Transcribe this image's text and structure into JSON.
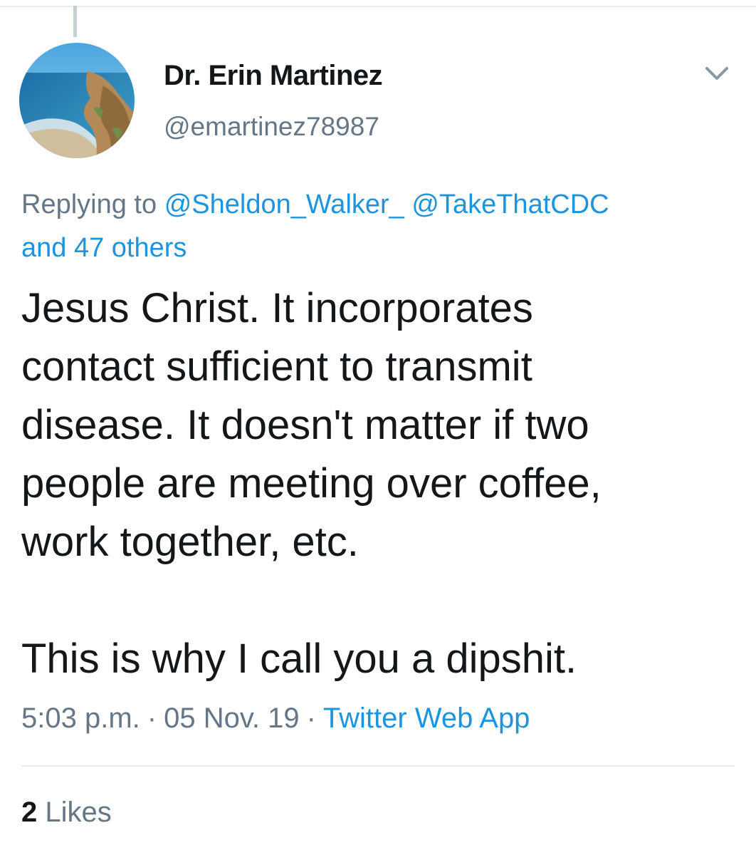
{
  "author": {
    "name": "Dr. Erin Martinez",
    "handle": "@emartinez78987",
    "avatar_icon": "beach-coastline-avatar"
  },
  "reply_context": {
    "prefix": "Replying to",
    "mentions": [
      "@Sheldon_Walker_",
      "@TakeThatCDC"
    ],
    "others": "and 47 others"
  },
  "tweet": {
    "lines": [
      "Jesus Christ. It incorporates",
      "contact sufficient to transmit",
      "disease. It doesn't matter if two",
      "people are meeting over coffee,",
      "work together, etc."
    ],
    "closing": "This is why I call you a dipshit."
  },
  "meta": {
    "time": "5:03 p.m.",
    "separator": "·",
    "date": "05 Nov. 19",
    "source": "Twitter Web App"
  },
  "stats": {
    "likes_count": "2",
    "likes_label": "Likes"
  },
  "icons": {
    "more": "chevron-down-icon"
  },
  "colors": {
    "text": "#14171a",
    "secondary": "#657786",
    "link": "#1b95e0",
    "divider": "#e6ecf0"
  }
}
